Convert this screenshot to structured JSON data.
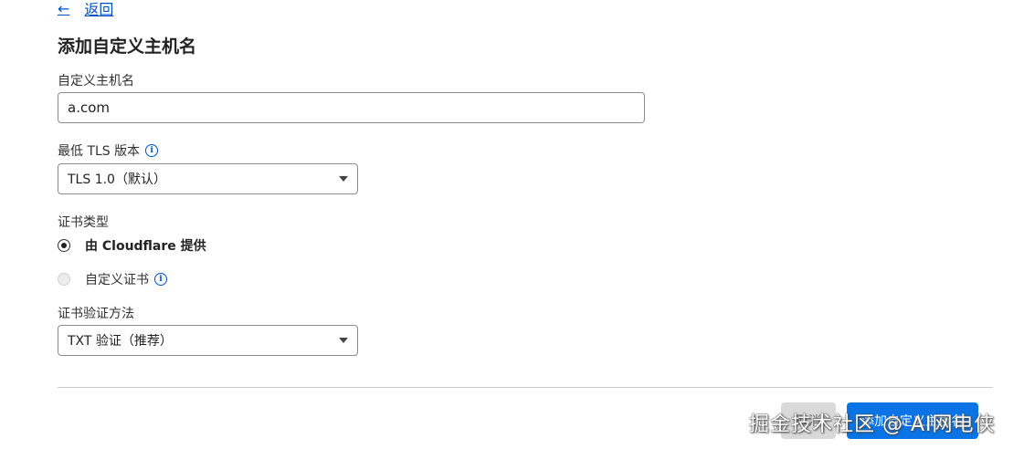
{
  "nav": {
    "back_arrow": "←",
    "back_label": "返回"
  },
  "title": "添加自定义主机名",
  "hostname": {
    "label": "自定义主机名",
    "value": "a.com"
  },
  "tls": {
    "label": "最低 TLS 版本",
    "value": "TLS 1.0（默认）"
  },
  "cert_type": {
    "label": "证书类型",
    "options": [
      {
        "label": "由 Cloudflare 提供",
        "selected": true
      },
      {
        "label": "自定义证书",
        "selected": false
      }
    ]
  },
  "verification": {
    "label": "证书验证方法",
    "value": "TXT 验证（推荐）"
  },
  "footer": {
    "cancel_label": "取消",
    "submit_label": "添加自定义主机名"
  },
  "watermark": "掘金技术社区 @ AI网电侠",
  "icons": {
    "info": "info-icon",
    "back": "arrow-left-icon",
    "dropdown": "chevron-down-icon"
  },
  "colors": {
    "link": "#0051c3",
    "primary": "#0a74e6",
    "border": "#8c8c8c"
  }
}
